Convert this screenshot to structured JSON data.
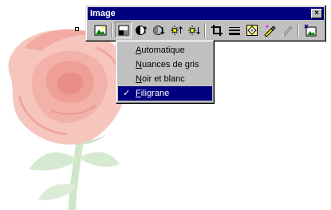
{
  "window": {
    "title": "Image",
    "close_label": "×"
  },
  "toolbar": {
    "buttons": [
      {
        "name": "insert-image-icon",
        "tooltip": ""
      },
      {
        "name": "image-control-icon",
        "pressed": true
      },
      {
        "name": "more-contrast-icon"
      },
      {
        "name": "less-contrast-icon"
      },
      {
        "name": "more-brightness-icon"
      },
      {
        "name": "less-brightness-icon"
      },
      {
        "name": "crop-icon"
      },
      {
        "name": "line-style-icon"
      },
      {
        "name": "format-picture-icon"
      },
      {
        "name": "set-transparent-color-icon"
      },
      {
        "name": "disabled-pen-icon"
      },
      {
        "name": "reset-picture-icon"
      }
    ]
  },
  "menu": {
    "items": [
      {
        "label_u": "A",
        "label_rest": "utomatique",
        "checked": false,
        "selected": false
      },
      {
        "label_u": "N",
        "label_rest": "uances de gris",
        "checked": false,
        "selected": false
      },
      {
        "label_u": "N",
        "label_rest": "oir et blanc",
        "checked": false,
        "selected": false
      },
      {
        "label_u": "F",
        "label_rest": "iligrane",
        "checked": true,
        "selected": true,
        "check_glyph": "✓"
      }
    ]
  },
  "colors": {
    "titlebar": "#000080",
    "face": "#c0c0c0",
    "highlight": "#000080",
    "rose": "#f4b8b0",
    "stem": "#cfe6c9"
  }
}
